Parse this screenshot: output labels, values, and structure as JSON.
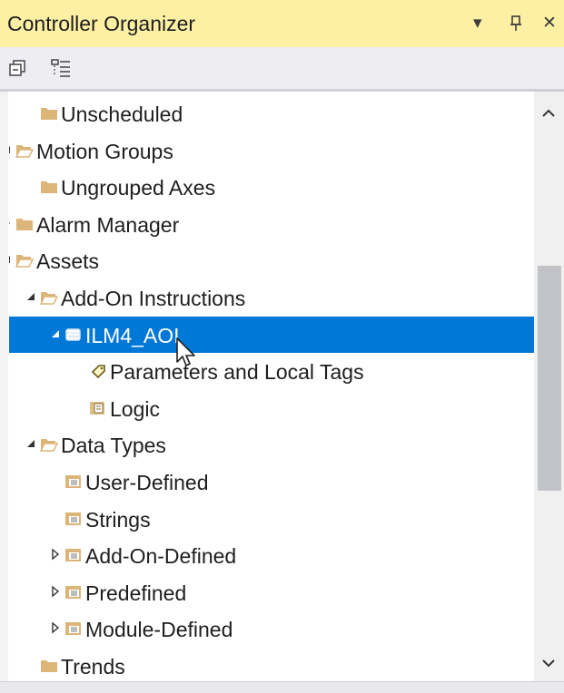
{
  "window": {
    "title": "Controller Organizer",
    "buttons": {
      "dropdown": "▾",
      "pin": "⊥",
      "close": "✕"
    }
  },
  "toolbar": {
    "icons": [
      "collapse-all-icon",
      "properties-view-icon"
    ]
  },
  "tree": {
    "items": [
      {
        "label": "Unscheduled",
        "expander": "none",
        "icon": "folder-icon",
        "selected": false
      },
      {
        "label": "Motion Groups",
        "expander": "expanded",
        "icon": "folder-open-icon",
        "selected": false
      },
      {
        "label": "Ungrouped Axes",
        "expander": "none",
        "icon": "folder-icon",
        "selected": false
      },
      {
        "label": "Alarm Manager",
        "expander": "collapsed",
        "icon": "folder-icon",
        "selected": false
      },
      {
        "label": "Assets",
        "expander": "expanded",
        "icon": "folder-open-icon",
        "selected": false
      },
      {
        "label": "Add-On Instructions",
        "expander": "expanded",
        "icon": "folder-open-icon",
        "selected": false
      },
      {
        "label": "ILM4_AOI",
        "expander": "expanded",
        "icon": "aoi-icon",
        "selected": true
      },
      {
        "label": "Parameters and Local Tags",
        "expander": "none",
        "icon": "tag-icon",
        "selected": false
      },
      {
        "label": "Logic",
        "expander": "none",
        "icon": "logic-icon",
        "selected": false
      },
      {
        "label": "Data Types",
        "expander": "expanded",
        "icon": "folder-open-icon",
        "selected": false
      },
      {
        "label": "User-Defined",
        "expander": "none",
        "icon": "datatype-icon",
        "selected": false
      },
      {
        "label": "Strings",
        "expander": "none",
        "icon": "datatype-icon",
        "selected": false
      },
      {
        "label": "Add-On-Defined",
        "expander": "collapsed",
        "icon": "datatype-icon",
        "selected": false
      },
      {
        "label": "Predefined",
        "expander": "collapsed",
        "icon": "datatype-icon",
        "selected": false
      },
      {
        "label": "Module-Defined",
        "expander": "collapsed",
        "icon": "datatype-icon",
        "selected": false
      },
      {
        "label": "Trends",
        "expander": "none",
        "icon": "folder-icon",
        "selected": false
      }
    ]
  },
  "colors": {
    "title_bar": "#fdf0a4",
    "selection": "#0078d7",
    "folder": "#dcb679"
  }
}
